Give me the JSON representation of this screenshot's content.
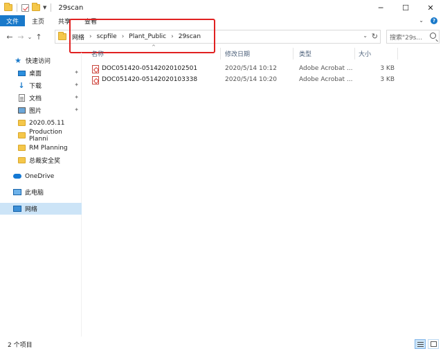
{
  "window": {
    "title": "29scan",
    "minimize_glyph": "─",
    "maximize_glyph": "☐",
    "close_glyph": "✕"
  },
  "ribbon": {
    "tabs": [
      {
        "label": "文件",
        "active": true
      },
      {
        "label": "主页",
        "active": false
      },
      {
        "label": "共享",
        "active": false
      },
      {
        "label": "查看",
        "active": false
      }
    ],
    "expand_glyph": "⌄",
    "help_glyph": "?"
  },
  "nav": {
    "back_glyph": "←",
    "forward_glyph": "→",
    "recent_glyph": "⌄",
    "up_glyph": "↑",
    "breadcrumb": [
      "网络",
      "scpfile",
      "Plant_Public",
      "29scan"
    ],
    "crumb_sep": "›",
    "dropdown_glyph": "⌄",
    "refresh_glyph": "↻",
    "search_placeholder": "搜索\"29s..."
  },
  "sidebar": {
    "items": [
      {
        "label": "快速访问",
        "icon": "star-icon",
        "pinned": false,
        "selected": false
      },
      {
        "label": "桌面",
        "icon": "desktop-icon",
        "pinned": true,
        "selected": false
      },
      {
        "label": "下载",
        "icon": "download-icon",
        "pinned": true,
        "selected": false
      },
      {
        "label": "文档",
        "icon": "document-icon",
        "pinned": true,
        "selected": false
      },
      {
        "label": "图片",
        "icon": "pictures-icon",
        "pinned": true,
        "selected": false
      },
      {
        "label": "2020.05.11",
        "icon": "folder-icon",
        "pinned": false,
        "selected": false
      },
      {
        "label": "Production Planni",
        "icon": "folder-icon",
        "pinned": false,
        "selected": false
      },
      {
        "label": "RM Planning",
        "icon": "folder-icon",
        "pinned": false,
        "selected": false
      },
      {
        "label": "总裁安全奖",
        "icon": "folder-icon",
        "pinned": false,
        "selected": false
      },
      {
        "label": "OneDrive",
        "icon": "onedrive-icon",
        "pinned": false,
        "selected": false
      },
      {
        "label": "此电脑",
        "icon": "this-pc-icon",
        "pinned": false,
        "selected": false
      },
      {
        "label": "网络",
        "icon": "network-icon",
        "pinned": false,
        "selected": true
      }
    ],
    "pin_glyph": "📌"
  },
  "filelist": {
    "columns": [
      "名称",
      "修改日期",
      "类型",
      "大小"
    ],
    "sort_glyph": "^",
    "rows": [
      {
        "name": "DOC051420-05142020102501",
        "modified": "2020/5/14 10:12",
        "type": "Adobe Acrobat ...",
        "size": "3 KB"
      },
      {
        "name": "DOC051420-05142020103338",
        "modified": "2020/5/14 10:20",
        "type": "Adobe Acrobat ...",
        "size": "3 KB"
      }
    ]
  },
  "status": {
    "item_count": "2 个项目"
  },
  "colors": {
    "accent": "#1979ca",
    "selection": "#cce4f7",
    "annotation": "#e02020"
  }
}
